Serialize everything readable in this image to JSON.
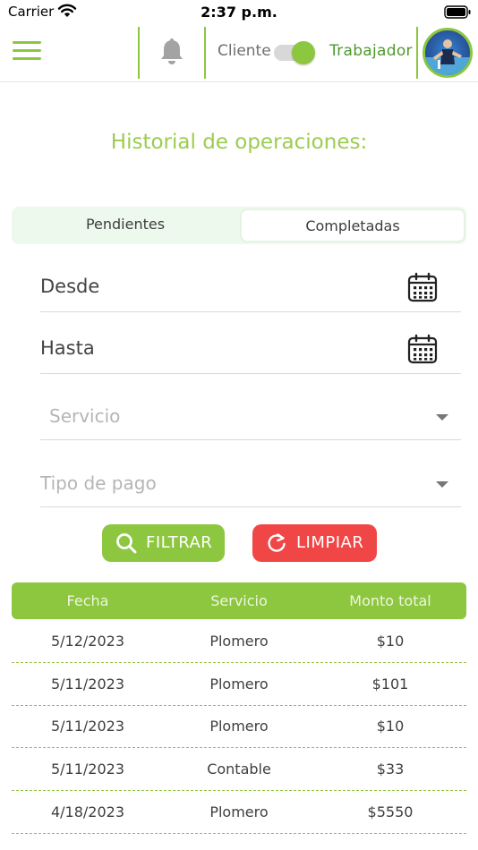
{
  "status_bar": {
    "carrier": "Carrier",
    "time": "2:37 p.m."
  },
  "header": {
    "menu_icon": "hamburger-menu-icon",
    "notification_icon": "bell-icon",
    "toggle_left_label": "Cliente",
    "toggle_right_label": "Trabajador",
    "toggle_on": true,
    "accent_color": "#8dc63f"
  },
  "title": "Historial de operaciones:",
  "tabs": [
    {
      "label": "Pendientes",
      "selected": false
    },
    {
      "label": "Completadas",
      "selected": true
    }
  ],
  "filters": {
    "desde_label": "Desde",
    "hasta_label": "Hasta",
    "calendar_icon": "calendar-icon",
    "servicio_placeholder": "Servicio",
    "tipo_pago_placeholder": "Tipo de pago"
  },
  "buttons": {
    "filtrar": "FILTRAR",
    "filtrar_icon": "search-icon",
    "filtrar_color": "#8dc63f",
    "limpiar": "LIMPIAR",
    "limpiar_icon": "refresh-icon",
    "limpiar_color": "#f14646"
  },
  "table": {
    "headers": [
      "Fecha",
      "Servicio",
      "Monto total"
    ],
    "rows": [
      [
        "5/12/2023",
        "Plomero",
        "$10"
      ],
      [
        "5/11/2023",
        "Plomero",
        "$101"
      ],
      [
        "5/11/2023",
        "Plomero",
        "$10"
      ],
      [
        "5/11/2023",
        "Contable",
        "$33"
      ],
      [
        "4/18/2023",
        "Plomero",
        "$5550"
      ]
    ]
  }
}
